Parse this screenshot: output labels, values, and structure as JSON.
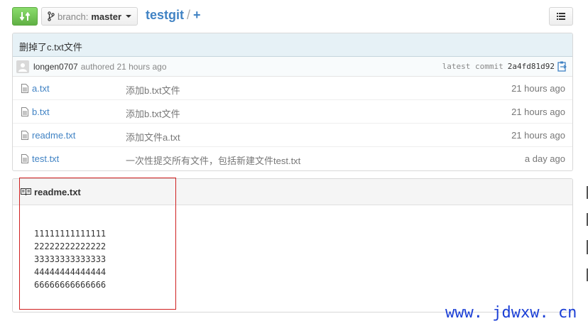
{
  "toolbar": {
    "branch_word": "branch:",
    "branch_name": "master",
    "repo_name": "testgit",
    "separator": "/",
    "add_label": "+"
  },
  "commit": {
    "message": "删掉了c.txt文件",
    "author": "longen0707",
    "authored_label": "authored 21 hours ago",
    "latest_label": "latest commit",
    "sha": "2a4fd81d92"
  },
  "files": [
    {
      "name": "a.txt",
      "message": "添加b.txt文件",
      "age": "21 hours ago"
    },
    {
      "name": "b.txt",
      "message": "添加b.txt文件",
      "age": "21 hours ago"
    },
    {
      "name": "readme.txt",
      "message": "添加文件a.txt",
      "age": "21 hours ago"
    },
    {
      "name": "test.txt",
      "message": "一次性提交所有文件，包括新建文件test.txt",
      "age": "a day ago"
    }
  ],
  "readme": {
    "title": "readme.txt",
    "lines": [
      "11111111111111",
      "22222222222222",
      "33333333333333",
      "44444444444444",
      "66666666666666"
    ]
  },
  "watermark": "www. jdwxw. cn",
  "colors": {
    "accent": "#4183c4",
    "compare_green": "#60b044",
    "highlight_red": "#d02020",
    "watermark_blue": "#1b3fd6"
  },
  "icons": [
    "compare-icon",
    "branch-icon",
    "list-icon",
    "avatar-icon",
    "clipboard-icon",
    "file-icon",
    "book-icon"
  ]
}
